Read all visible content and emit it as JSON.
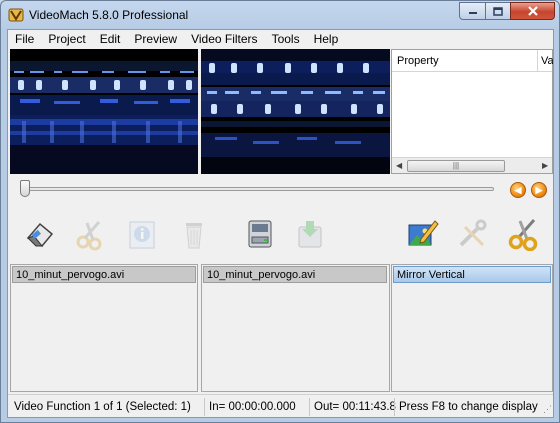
{
  "window": {
    "title": "VideoMach 5.8.0 Professional",
    "icon": "app-logo-icon",
    "controls": [
      "minimize-icon",
      "maximize-icon",
      "close-icon"
    ]
  },
  "menubar": {
    "items": [
      "File",
      "Project",
      "Edit",
      "Preview",
      "Video Filters",
      "Tools",
      "Help"
    ]
  },
  "preview": {
    "left": "source video preview",
    "right": "output video preview (mirrored vertically)"
  },
  "property_panel": {
    "columns": [
      "Property",
      "Val"
    ]
  },
  "seek": {
    "position": 0.0,
    "prev_icon": "arrow-left-circle-icon",
    "next_icon": "arrow-right-circle-icon"
  },
  "toolbar": {
    "buttons": [
      {
        "icon": "eraser-icon",
        "enabled": true
      },
      {
        "icon": "scissors-icon",
        "enabled": false
      },
      {
        "icon": "info-icon",
        "enabled": false
      },
      {
        "icon": "trash-icon",
        "enabled": false
      },
      {
        "icon": "disk-drive-icon",
        "enabled": true
      },
      {
        "icon": "save-output-icon",
        "enabled": false
      },
      {
        "icon": "edit-image-icon",
        "enabled": true
      },
      {
        "icon": "tools-icon",
        "enabled": false
      },
      {
        "icon": "cut-scissors-icon",
        "enabled": true
      }
    ]
  },
  "lists": {
    "input_files": [
      "10_minut_pervogo.avi"
    ],
    "output_files": [
      "10_minut_pervogo.avi"
    ],
    "filters": [
      "Mirror Vertical"
    ]
  },
  "status": {
    "function": "Video Function 1 of 1  (Selected: 1)",
    "in": "In= 00:00:00.000",
    "out": "Out= 00:11:43.8",
    "hint": "Press F8 to change display"
  },
  "colors": {
    "selection": "#a9c8ea",
    "accent_orange": "#f08a16"
  }
}
